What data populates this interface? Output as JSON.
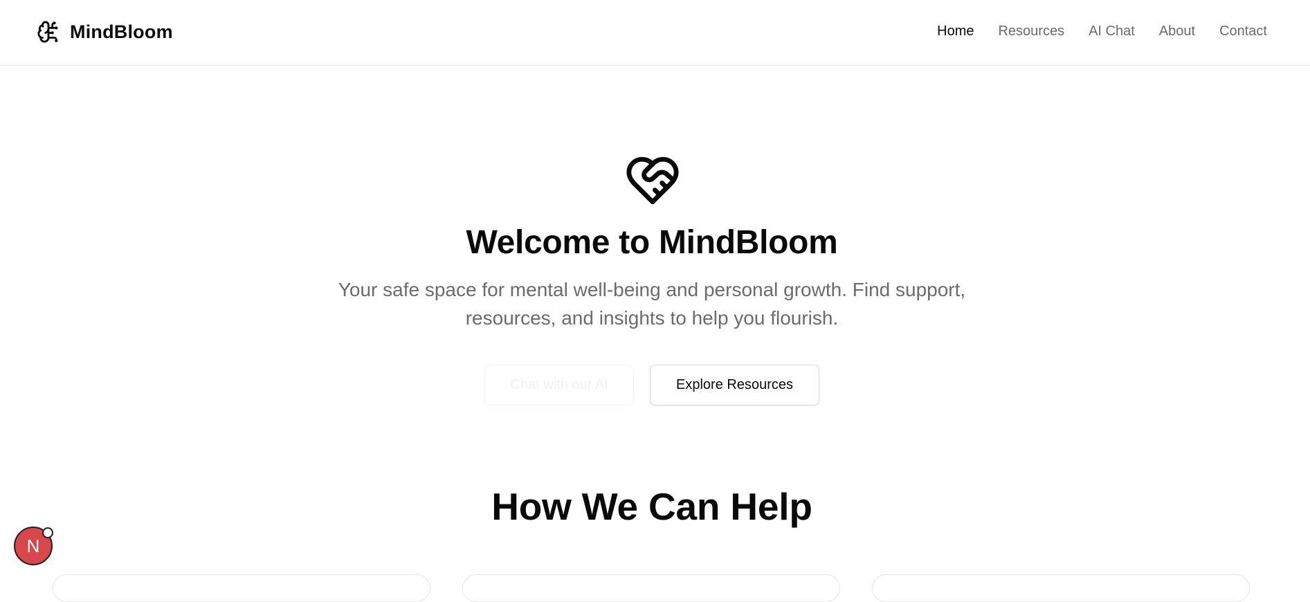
{
  "brand": {
    "name": "MindBloom",
    "icon": "brain-icon"
  },
  "nav": {
    "items": [
      {
        "label": "Home",
        "active": true
      },
      {
        "label": "Resources",
        "active": false
      },
      {
        "label": "AI Chat",
        "active": false
      },
      {
        "label": "About",
        "active": false
      },
      {
        "label": "Contact",
        "active": false
      }
    ]
  },
  "hero": {
    "icon": "handshake-heart-icon",
    "title": "Welcome to MindBloom",
    "subtitle": "Your safe space for mental well-being and personal growth. Find support, resources, and insights to help you flourish.",
    "primary_button": "Chat with our AI",
    "secondary_button": "Explore Resources"
  },
  "features": {
    "title": "How We Can Help"
  },
  "dev_badge": {
    "label": "N"
  },
  "colors": {
    "text": "#0a0a0a",
    "muted": "#6b6b6b",
    "border": "#e5e7eb",
    "badge": "#d8474c"
  }
}
